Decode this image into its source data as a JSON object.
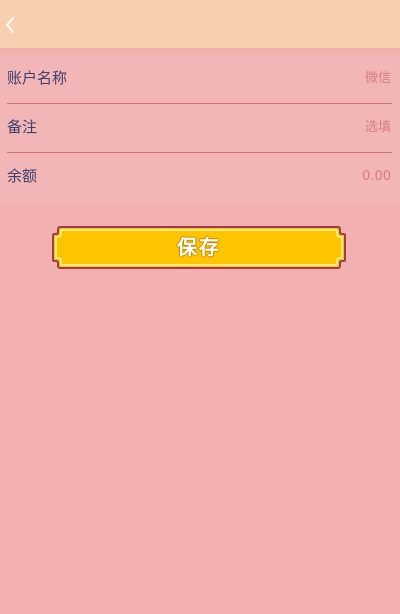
{
  "header": {
    "back_icon": "chevron-left-icon"
  },
  "form": {
    "account_name_label": "账户名称",
    "account_name_value": "微信",
    "note_label": "备注",
    "note_placeholder": "选填",
    "balance_label": "余额",
    "balance_value": "0.00"
  },
  "actions": {
    "save_label": "保存"
  },
  "colors": {
    "page_background": "#f2b1b0",
    "header_background": "#f8d0b0",
    "label_text": "#3d3f6e",
    "value_text": "#d67d84",
    "divider": "#e36b74",
    "save_button": "#fdc500"
  }
}
